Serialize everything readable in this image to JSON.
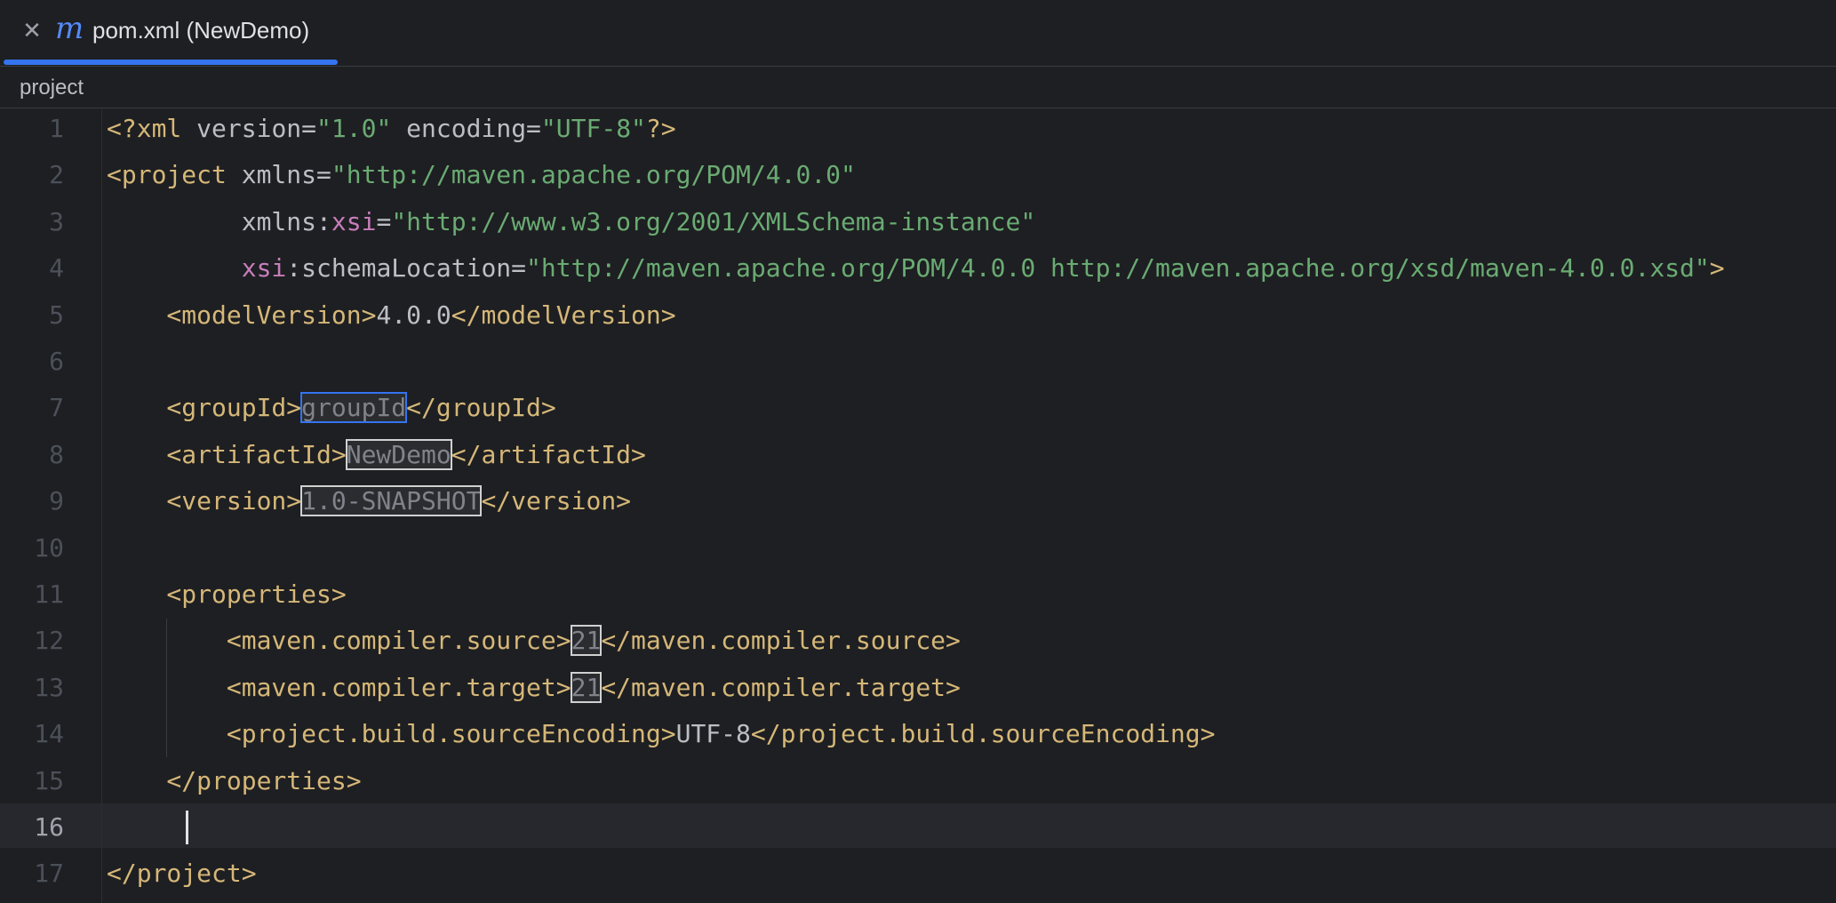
{
  "tab": {
    "close_glyph": "✕",
    "icon_glyph": "m",
    "icon_name": "maven-icon",
    "label": "pom.xml (NewDemo)"
  },
  "breadcrumb": "project",
  "colors": {
    "background": "#1e1f22",
    "tag": "#d5b778",
    "string": "#6aab73",
    "namespace": "#c77dbb",
    "accent": "#3574f0"
  },
  "lines": [
    {
      "n": "1",
      "segments": [
        {
          "t": "<?xml ",
          "c": "tag"
        },
        {
          "t": "version",
          "c": "attr"
        },
        {
          "t": "=",
          "c": "attr"
        },
        {
          "t": "\"1.0\"",
          "c": "str"
        },
        {
          "t": " encoding",
          "c": "attr"
        },
        {
          "t": "=",
          "c": "attr"
        },
        {
          "t": "\"UTF-8\"",
          "c": "str"
        },
        {
          "t": "?>",
          "c": "tag"
        }
      ]
    },
    {
      "n": "2",
      "segments": [
        {
          "t": "<project ",
          "c": "tag"
        },
        {
          "t": "xmlns",
          "c": "attr"
        },
        {
          "t": "=",
          "c": "attr"
        },
        {
          "t": "\"http://maven.apache.org/POM/4.0.0\"",
          "c": "str"
        }
      ]
    },
    {
      "n": "3",
      "segments": [
        {
          "t": "         xmlns",
          "c": "attr"
        },
        {
          "t": ":",
          "c": "attr"
        },
        {
          "t": "xsi",
          "c": "ns"
        },
        {
          "t": "=",
          "c": "attr"
        },
        {
          "t": "\"http://www.w3.org/2001/XMLSchema-instance\"",
          "c": "str"
        }
      ]
    },
    {
      "n": "4",
      "segments": [
        {
          "t": "         ",
          "c": "attr"
        },
        {
          "t": "xsi",
          "c": "ns"
        },
        {
          "t": ":schemaLocation",
          "c": "attr"
        },
        {
          "t": "=",
          "c": "attr"
        },
        {
          "t": "\"http://maven.apache.org/POM/4.0.0 http://maven.apache.org/xsd/maven-4.0.0.xsd\"",
          "c": "str"
        },
        {
          "t": ">",
          "c": "tag"
        }
      ]
    },
    {
      "n": "5",
      "segments": [
        {
          "t": "    <modelVersion>",
          "c": "tag"
        },
        {
          "t": "4.0.0",
          "c": "txt"
        },
        {
          "t": "</modelVersion>",
          "c": "tag"
        }
      ]
    },
    {
      "n": "6",
      "segments": []
    },
    {
      "n": "7",
      "segments": [
        {
          "t": "    <groupId>",
          "c": "tag"
        },
        {
          "t": "groupId",
          "c": "tpl active-tpl"
        },
        {
          "t": "</groupId>",
          "c": "tag"
        }
      ]
    },
    {
      "n": "8",
      "segments": [
        {
          "t": "    <artifactId>",
          "c": "tag"
        },
        {
          "t": "NewDemo",
          "c": "tpl"
        },
        {
          "t": "</artifactId>",
          "c": "tag"
        }
      ]
    },
    {
      "n": "9",
      "segments": [
        {
          "t": "    <version>",
          "c": "tag"
        },
        {
          "t": "1.0-SNAPSHOT",
          "c": "tpl"
        },
        {
          "t": "</version>",
          "c": "tag"
        }
      ]
    },
    {
      "n": "10",
      "segments": []
    },
    {
      "n": "11",
      "segments": [
        {
          "t": "    <properties>",
          "c": "tag"
        }
      ]
    },
    {
      "n": "12",
      "segments": [
        {
          "t": "        <maven.compiler.source>",
          "c": "tag"
        },
        {
          "t": "21",
          "c": "tpl"
        },
        {
          "t": "</maven.compiler.source>",
          "c": "tag"
        }
      ]
    },
    {
      "n": "13",
      "segments": [
        {
          "t": "        <maven.compiler.target>",
          "c": "tag"
        },
        {
          "t": "21",
          "c": "tpl"
        },
        {
          "t": "</maven.compiler.target>",
          "c": "tag"
        }
      ]
    },
    {
      "n": "14",
      "segments": [
        {
          "t": "        <project.build.sourceEncoding>",
          "c": "tag"
        },
        {
          "t": "UTF-8",
          "c": "txt"
        },
        {
          "t": "</project.build.sourceEncoding>",
          "c": "tag"
        }
      ]
    },
    {
      "n": "15",
      "segments": [
        {
          "t": "    </properties>",
          "c": "tag"
        }
      ]
    },
    {
      "n": "16",
      "segments": [],
      "active": true
    },
    {
      "n": "17",
      "segments": [
        {
          "t": "</project>",
          "c": "tag"
        }
      ]
    }
  ]
}
